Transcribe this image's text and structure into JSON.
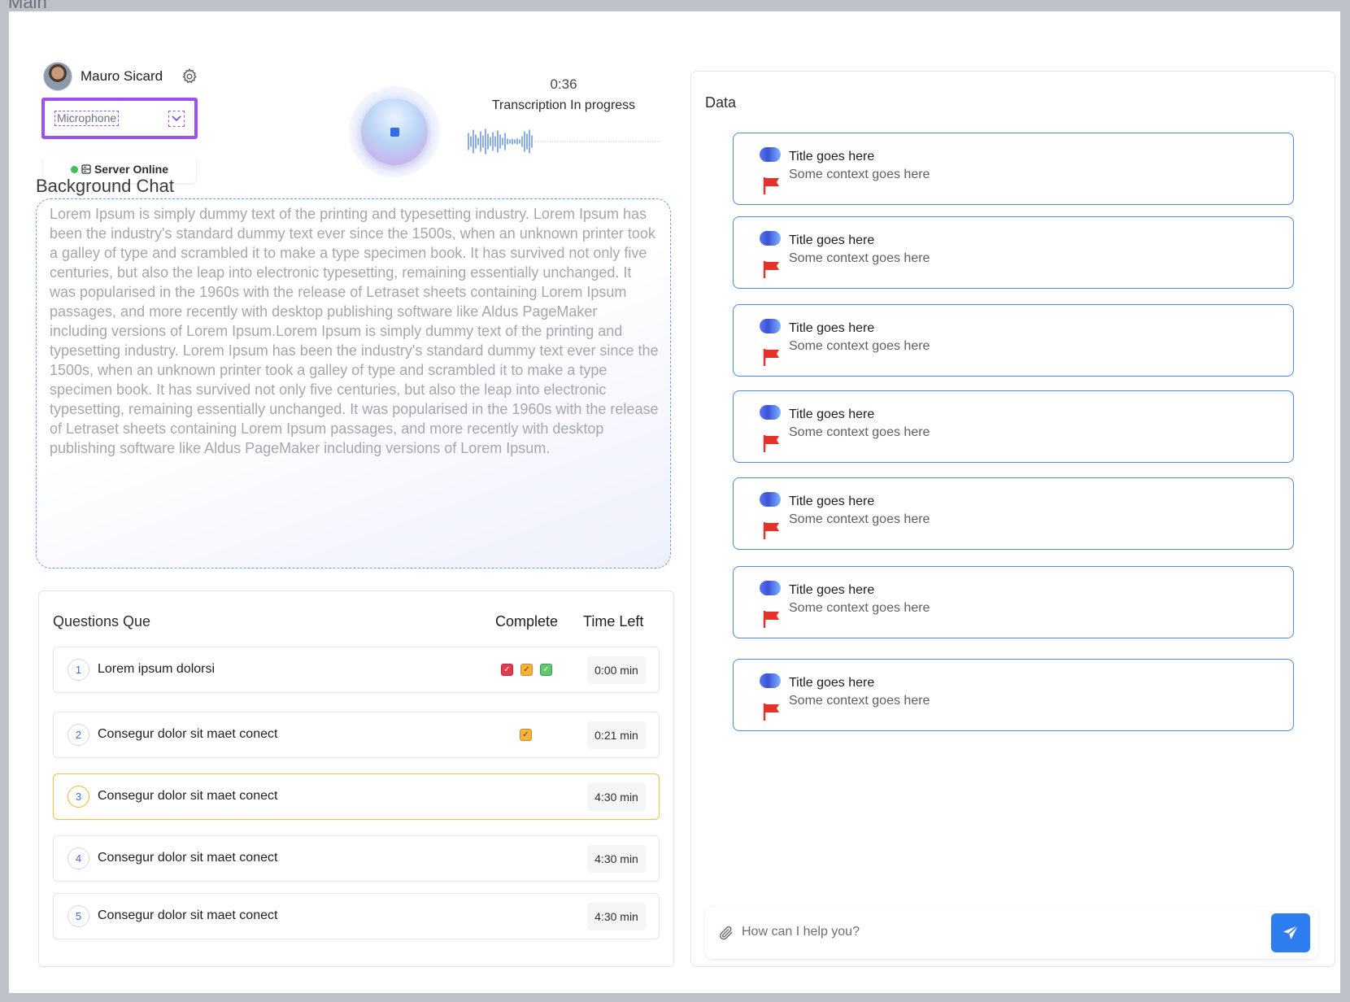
{
  "frame": {
    "label": "Main"
  },
  "user": {
    "name": "Mauro Sicard"
  },
  "microphone": {
    "label": "Microphone"
  },
  "server": {
    "status": "Server Online"
  },
  "recorder": {
    "timer": "0:36",
    "status": "Transcription In progress"
  },
  "background_chat": {
    "title": "Background Chat",
    "text": "Lorem Ipsum is simply dummy text of the printing and typesetting industry. Lorem Ipsum has been the industry's standard dummy text ever since the 1500s, when an unknown printer took a galley of type and scrambled it to make a type specimen book. It has survived not only five centuries, but also the leap into electronic typesetting, remaining essentially unchanged. It was popularised in the 1960s with the release of Letraset sheets containing Lorem Ipsum passages, and more recently with desktop publishing software like Aldus PageMaker including versions of Lorem Ipsum.Lorem Ipsum is simply dummy text of the printing and typesetting industry. Lorem Ipsum has been the industry's standard dummy text ever since the 1500s, when an unknown printer took a galley of type and scrambled it to make a type specimen book. It has survived not only five centuries, but also the leap into electronic typesetting, remaining essentially unchanged. It was popularised in the 1960s with the release of Letraset sheets containing Lorem Ipsum passages, and more recently with desktop publishing software like Aldus PageMaker including versions of Lorem Ipsum."
  },
  "questions": {
    "title": "Questions Que",
    "col_complete": "Complete",
    "col_time": "Time Left",
    "items": [
      {
        "num": "1",
        "text": "Lorem ipsum dolorsi",
        "time": "0:00 min",
        "checks": [
          "red",
          "yellow",
          "green"
        ],
        "active": false
      },
      {
        "num": "2",
        "text": "Consegur dolor sit maet conect",
        "time": "0:21 min",
        "checks": [
          "yellow"
        ],
        "active": false
      },
      {
        "num": "3",
        "text": "Consegur dolor sit maet conect",
        "time": "4:30 min",
        "checks": [],
        "active": true
      },
      {
        "num": "4",
        "text": "Consegur dolor sit maet conect",
        "time": "4:30 min",
        "checks": [],
        "active": false
      },
      {
        "num": "5",
        "text": "Consegur dolor sit maet conect",
        "time": "4:30 min",
        "checks": [],
        "active": false
      }
    ]
  },
  "data_panel": {
    "title": "Data",
    "cards": [
      {
        "title": "Title goes here",
        "subtitle": "Some context goes here"
      },
      {
        "title": "Title goes here",
        "subtitle": "Some context goes here"
      },
      {
        "title": "Title goes here",
        "subtitle": "Some context goes here"
      },
      {
        "title": "Title goes here",
        "subtitle": "Some context goes here"
      },
      {
        "title": "Title goes here",
        "subtitle": "Some context goes here"
      },
      {
        "title": "Title goes here",
        "subtitle": "Some context goes here"
      },
      {
        "title": "Title goes here",
        "subtitle": "Some context goes here"
      }
    ]
  },
  "chat": {
    "placeholder": "How can I help you?"
  },
  "colors": {
    "accent_blue": "#2f7ef0",
    "mic_outline": "#9b52f0",
    "active_row_border": "#f0c24a",
    "flag_red": "#e8302a",
    "online_green": "#3fbe5a"
  },
  "icons": {
    "settings": "gear-icon",
    "microphone_toggle": "chevron-down-icon",
    "server": "server-icon",
    "attach": "paperclip-icon",
    "send": "send-icon",
    "card_flag": "flag-icon"
  }
}
